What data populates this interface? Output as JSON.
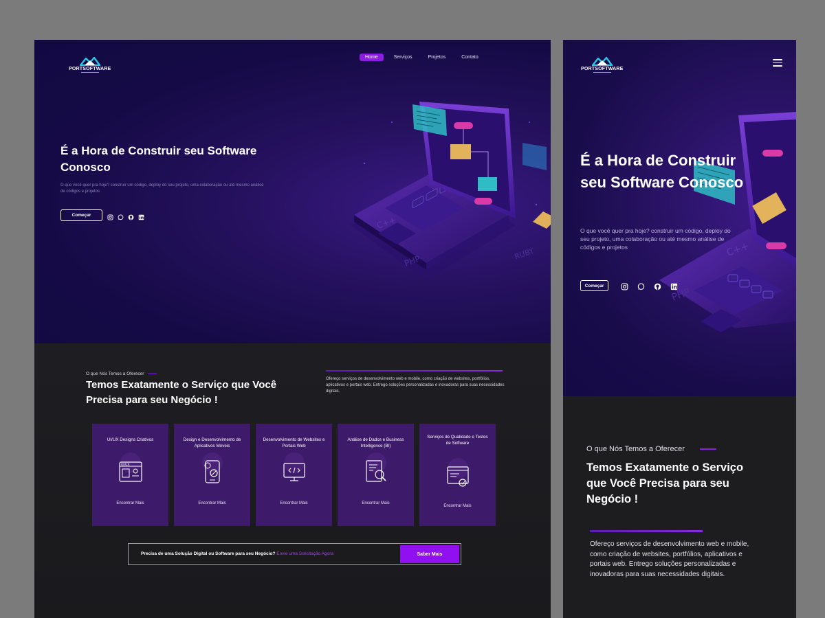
{
  "brand": {
    "name": "PORTSOFTWARE"
  },
  "colors": {
    "accent": "#8a1fe0",
    "hero_bg": "#150a45",
    "card_bg": "#3e1a6a",
    "cta_button": "#9010f0",
    "link": "#a73ff5"
  },
  "nav": {
    "items": [
      "Home",
      "Serviços",
      "Projetos",
      "Contato"
    ],
    "active": "Home"
  },
  "hero": {
    "title": "É a Hora de Construir seu Software Conosco",
    "text": "O que você quer pra hoje? construir um código, deploy do seu projeto, uma colaboração ou até mesmo análise de códigos e projetos",
    "button": "Começar",
    "socials": [
      "instagram-icon",
      "whatsapp-icon",
      "github-icon",
      "linkedin-icon"
    ]
  },
  "services": {
    "kicker": "O que Nós Temos a Oferecer",
    "title": "Temos Exatamente o Serviço que Você Precisa para seu Negócio !",
    "description": "Ofereço serviços de desenvolvimento web e mobile, como criação de websites, portfólios, aplicativos e portais web. Entrego soluções personalizadas e inovadoras para suas necessidades digitais.",
    "cards": [
      {
        "title": "UI/UX Designs Criativos",
        "icon": "ui-ux-icon",
        "more": "Encontrar Mais"
      },
      {
        "title": "Design e Desenvolvimento de Aplicativos Móveis",
        "icon": "mobile-app-icon",
        "more": "Encontrar Mais"
      },
      {
        "title": "Desenvolvimento de Websites e Portais Web",
        "icon": "web-code-icon",
        "more": "Encontrar Mais"
      },
      {
        "title": "Análise de Dados e Business Intelligence (BI)",
        "icon": "data-analysis-icon",
        "more": "Encontrar Mais"
      },
      {
        "title": "Serviços de Qualidade e Testes de Software",
        "icon": "qa-testing-icon",
        "more": "Encontrar Mais"
      }
    ]
  },
  "cta": {
    "text": "Precisa de uma Solução Digital ou Software para seu Negócio?",
    "link": "Envie uma Solicitação Agora",
    "button": "Saber Mais"
  },
  "mobile": {
    "hero_title": "É a Hora de Construir seu Software Conosco",
    "hero_text": "O que você quer pra hoje? construir um código, deploy do seu projeto, uma colaboração ou até mesmo análise de códigos e projetos",
    "button": "Começar",
    "menu_icon": "hamburger-menu-icon"
  }
}
